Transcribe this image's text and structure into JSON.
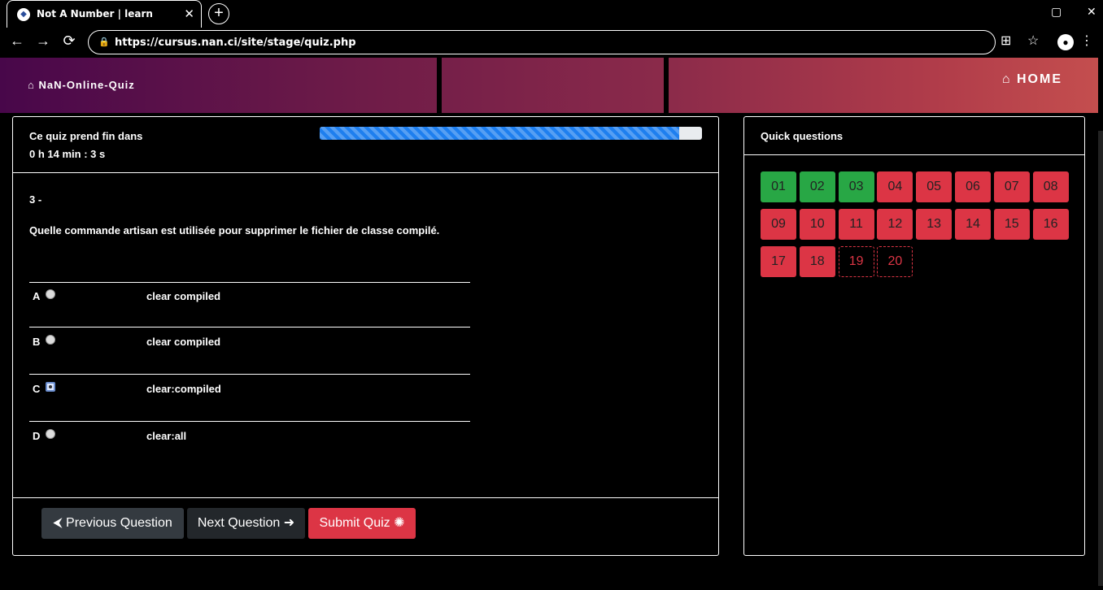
{
  "browser": {
    "tab_title": "Not A Number | learn",
    "tab_close": "✕",
    "new_tab": "+",
    "url": "https://cursus.nan.ci/site/stage/quiz.php",
    "restore": "▢",
    "close": "✕",
    "back": "←",
    "forward": "→",
    "reload": "⟳",
    "menu": "⋮"
  },
  "header": {
    "brand": "NaN-Online-Quiz",
    "home": "HOME"
  },
  "quiz": {
    "timer_label": "Ce quiz prend fin dans",
    "timer_value": "0 h 14 min : 3 s",
    "progress": 0.94,
    "question_number": "3 -",
    "question_text": "Quelle commande artisan est utilisée pour supprimer le fichier de classe compilé.",
    "options": [
      {
        "letter": "A",
        "text": "clear compiled",
        "checked": false
      },
      {
        "letter": "B",
        "text": "clear compiled",
        "checked": false
      },
      {
        "letter": "C",
        "text": "clear:compiled",
        "checked": true
      },
      {
        "letter": "D",
        "text": "clear:all",
        "checked": false
      }
    ],
    "prev_button": "Previous Question",
    "next_button": "Next Question",
    "submit_button": "Submit Quiz"
  },
  "quick": {
    "title": "Quick questions",
    "items": [
      {
        "label": "01",
        "state": "done"
      },
      {
        "label": "02",
        "state": "done"
      },
      {
        "label": "03",
        "state": "done"
      },
      {
        "label": "04",
        "state": "todo"
      },
      {
        "label": "05",
        "state": "todo"
      },
      {
        "label": "06",
        "state": "todo"
      },
      {
        "label": "07",
        "state": "todo"
      },
      {
        "label": "08",
        "state": "todo"
      },
      {
        "label": "09",
        "state": "todo"
      },
      {
        "label": "10",
        "state": "todo"
      },
      {
        "label": "11",
        "state": "todo"
      },
      {
        "label": "12",
        "state": "todo"
      },
      {
        "label": "13",
        "state": "todo"
      },
      {
        "label": "14",
        "state": "todo"
      },
      {
        "label": "15",
        "state": "todo"
      },
      {
        "label": "16",
        "state": "todo"
      },
      {
        "label": "17",
        "state": "todo"
      },
      {
        "label": "18",
        "state": "todo"
      },
      {
        "label": "19",
        "state": "empty"
      },
      {
        "label": "20",
        "state": "empty"
      }
    ]
  },
  "colors": {
    "done": "#28a745",
    "todo": "#dc3545",
    "progress": "#1e7fef"
  }
}
